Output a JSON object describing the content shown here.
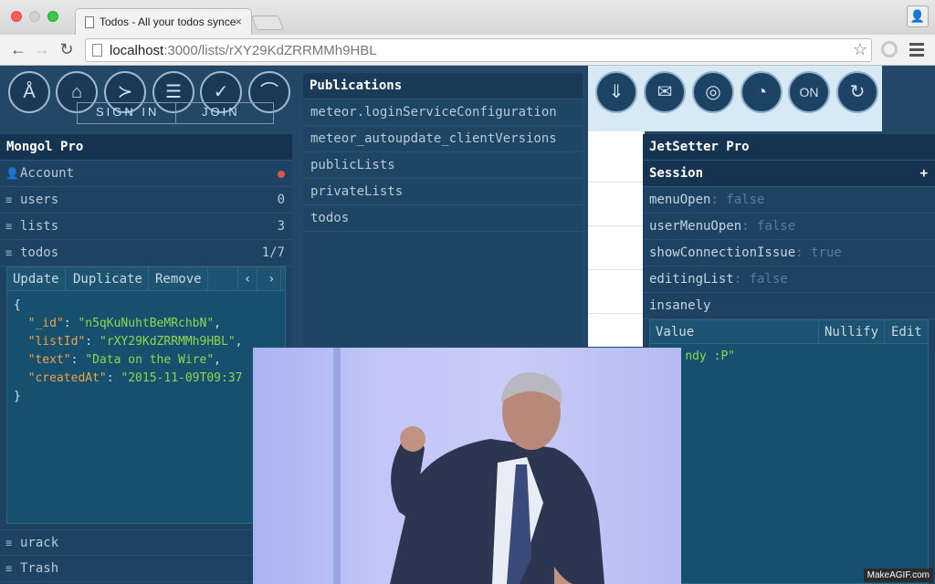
{
  "browser": {
    "tab_title": "Todos - All your todos synced",
    "tab_close": "×",
    "url_host": "localhost",
    "url_rest": ":3000/lists/rXY29KdZRRMMh9HBL",
    "back": "←",
    "forward": "→",
    "reload": "↻",
    "star": "☆"
  },
  "accounts": {
    "sign_in": "SIGN IN",
    "join": "JOIN"
  },
  "top_icons_left": [
    "accounts-icon",
    "user-icon",
    "terminal-icon",
    "list-icon",
    "check-icon",
    "dome-icon"
  ],
  "top_icons_right": [
    "download-icon",
    "mail-icon",
    "radar-icon",
    "gauge-icon",
    "power-on-icon",
    "refresh-icon"
  ],
  "power_label": "ON",
  "mongol": {
    "title": "Mongol Pro",
    "items": [
      {
        "label": "Account",
        "count": ""
      },
      {
        "label": "users",
        "count": "0"
      },
      {
        "label": "lists",
        "count": "3"
      },
      {
        "label": "todos",
        "count": "1/7"
      }
    ],
    "doc_buttons": {
      "update": "Update",
      "duplicate": "Duplicate",
      "remove": "Remove",
      "prev": "‹",
      "next": "›"
    },
    "doc": {
      "id_key": "\"_id\"",
      "id_val": "\"n5qKuNuhtBeMRchbN\"",
      "list_key": "\"listId\"",
      "list_val": "\"rXY29KdZRRMMh9HBL\"",
      "text_key": "\"text\"",
      "text_val": "\"Data on the Wire\"",
      "created_key": "\"createdAt\"",
      "created_val": "\"2015-11-09T09:37"
    },
    "bottom_items": [
      {
        "label": "urack"
      },
      {
        "label": "Trash"
      }
    ]
  },
  "publications": {
    "title": "Publications",
    "items": [
      "meteor.loginServiceConfiguration",
      "meteor_autoupdate_clientVersions",
      "publicLists",
      "privateLists",
      "todos"
    ]
  },
  "jetsetter": {
    "title": "JetSetter Pro",
    "session_label": "Session",
    "session_add": "+",
    "vars": [
      {
        "key": "menuOpen",
        "value": ": false"
      },
      {
        "key": "userMenuOpen",
        "value": ": false"
      },
      {
        "key": "showConnectionIssue",
        "value": ": true"
      },
      {
        "key": "editingList",
        "value": ": false"
      },
      {
        "key": "insanely",
        "value": ""
      }
    ],
    "editor": {
      "value_label": "Value",
      "nullify": "Nullify",
      "edit": "Edit",
      "content": "ndy :P\""
    }
  },
  "watermark": "MakeAGIF.com"
}
